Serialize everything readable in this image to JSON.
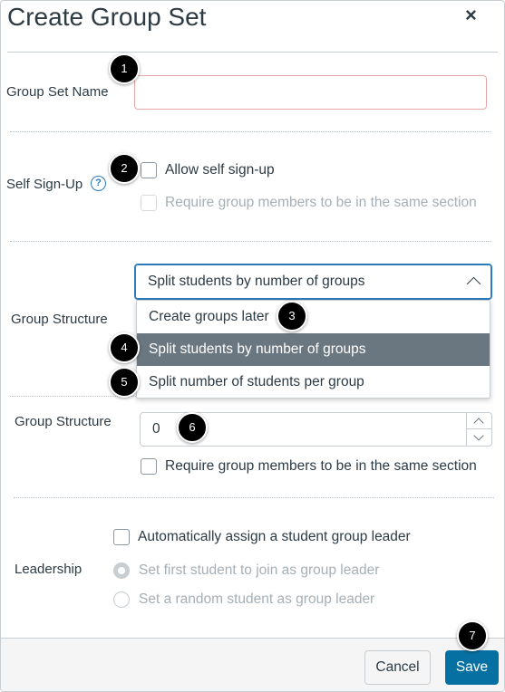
{
  "dialog": {
    "title": "Create Group Set",
    "close_symbol": "×"
  },
  "group_set_name": {
    "label": "Group Set Name",
    "value": ""
  },
  "self_signup": {
    "label": "Self Sign-Up",
    "help_symbol": "?",
    "allow_label": "Allow self sign-up",
    "allow_checked": false,
    "require_section_label": "Require group members to be in the same section",
    "require_section_disabled": true
  },
  "group_structure": {
    "label": "Group Structure",
    "selected": "Split students by number of groups",
    "options": [
      "Create groups later",
      "Split students by number of groups",
      "Split number of students per group"
    ],
    "selected_index": 1
  },
  "group_count": {
    "label": "Group Structure",
    "value": "0",
    "require_section_label": "Require group members to be in the same section"
  },
  "leadership": {
    "label": "Leadership",
    "auto_assign_label": "Automatically assign a student group leader",
    "first_student_label": "Set first student to join as group leader",
    "random_student_label": "Set a random student as group leader"
  },
  "footer": {
    "cancel_label": "Cancel",
    "save_label": "Save"
  },
  "badges": [
    "1",
    "2",
    "3",
    "4",
    "5",
    "6",
    "7"
  ],
  "colors": {
    "primary_button": "#0770a3",
    "selected_option": "#6b7780",
    "focus_border": "#2b7abc",
    "badge": "#000000"
  }
}
